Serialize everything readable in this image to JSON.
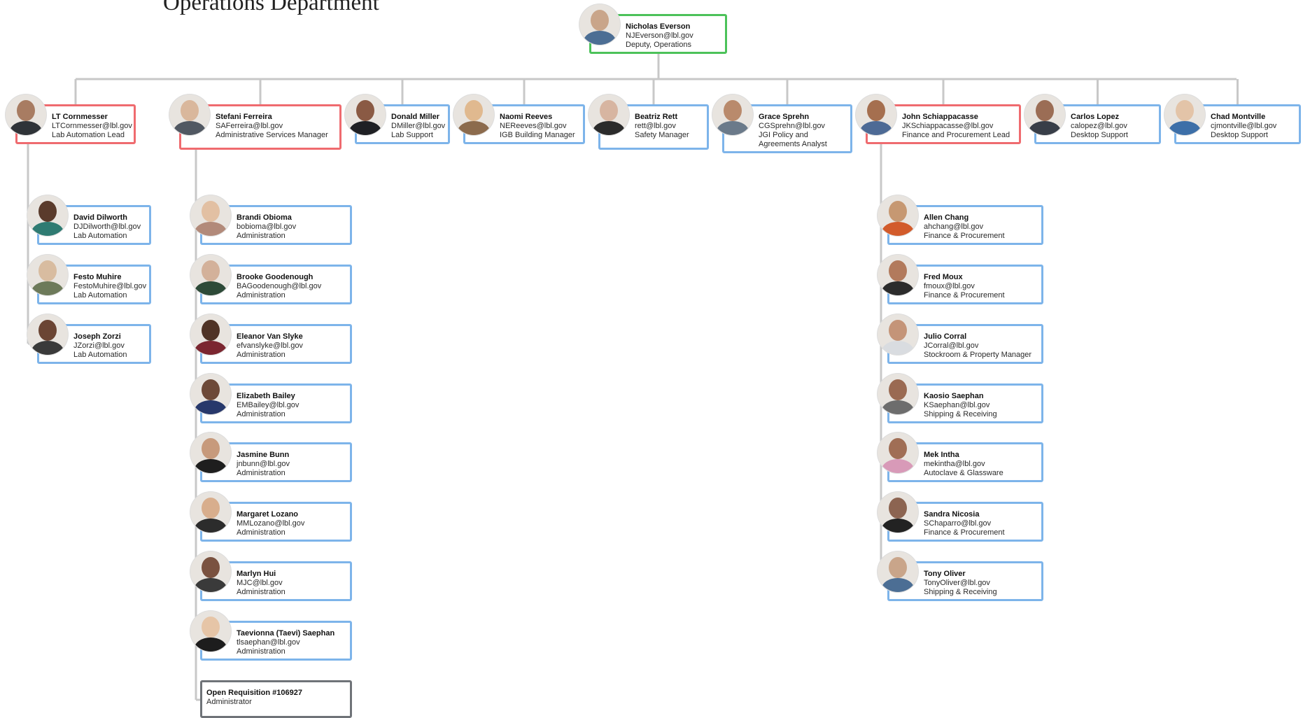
{
  "title": "Operations Department",
  "colors": {
    "line": "#c8c8c8",
    "manager_border": "#ef6b6f",
    "head_border": "#4cc25a",
    "staff_border": "#7db4ea",
    "open_border": "#6f7378"
  },
  "head": {
    "name": "Nicholas Everson",
    "email": "NJEverson@lbl.gov",
    "role": "Deputy, Operations"
  },
  "direct_reports": [
    {
      "name": "LT Cornmesser",
      "email": "LTCornmesser@lbl.gov",
      "role": "Lab Automation Lead"
    },
    {
      "name": "Stefani Ferreira",
      "email": "SAFerreira@lbl.gov",
      "role": "Administrative Services Manager"
    },
    {
      "name": "Donald Miller",
      "email": "DMiller@lbl.gov",
      "role": "Lab Support"
    },
    {
      "name": "Naomi Reeves",
      "email": "NEReeves@lbl.gov",
      "role": "IGB Building Manager"
    },
    {
      "name": "Beatriz Rett",
      "email": "rett@lbl.gov",
      "role": "Safety Manager"
    },
    {
      "name": "Grace Sprehn",
      "email": "CGSprehn@lbl.gov",
      "role": "JGI Policy and",
      "role2": "Agreements Analyst"
    },
    {
      "name": "John Schiappacasse",
      "email": "JKSchiappacasse@lbl.gov",
      "role": "Finance and Procurement Lead"
    },
    {
      "name": "Carlos Lopez",
      "email": "calopez@lbl.gov",
      "role": "Desktop Support"
    },
    {
      "name": "Chad Montville",
      "email": "cjmontville@lbl.gov",
      "role": "Desktop Support"
    }
  ],
  "lab_automation_team": [
    {
      "name": "David Dilworth",
      "email": "DJDilworth@lbl.gov",
      "role": "Lab Automation"
    },
    {
      "name": "Festo Muhire",
      "email": "FestoMuhire@lbl.gov",
      "role": "Lab Automation"
    },
    {
      "name": "Joseph Zorzi",
      "email": "JZorzi@lbl.gov",
      "role": "Lab Automation"
    }
  ],
  "administration_team": [
    {
      "name": "Brandi Obioma",
      "email": "bobioma@lbl.gov",
      "role": "Administration"
    },
    {
      "name": "Brooke Goodenough",
      "email": "BAGoodenough@lbl.gov",
      "role": "Administration"
    },
    {
      "name": "Eleanor Van Slyke",
      "email": "efvanslyke@lbl.gov",
      "role": "Administration"
    },
    {
      "name": "Elizabeth Bailey",
      "email": "EMBailey@lbl.gov",
      "role": "Administration"
    },
    {
      "name": "Jasmine Bunn",
      "email": "jnbunn@lbl.gov",
      "role": "Administration"
    },
    {
      "name": "Margaret Lozano",
      "email": "MMLozano@lbl.gov",
      "role": "Administration"
    },
    {
      "name": "Marlyn Hui",
      "email": "MJC@lbl.gov",
      "role": "Administration"
    },
    {
      "name": "Taevionna (Taevi) Saephan",
      "email": "tlsaephan@lbl.gov",
      "role": "Administration"
    }
  ],
  "open_requisition": {
    "name": "Open Requisition #106927",
    "role": "Administrator"
  },
  "finance_team": [
    {
      "name": "Allen Chang",
      "email": "ahchang@lbl.gov",
      "role": "Finance & Procurement"
    },
    {
      "name": "Fred Moux",
      "email": "fmoux@lbl.gov",
      "role": "Finance & Procurement"
    },
    {
      "name": "Julio Corral",
      "email": "JCorral@lbl.gov",
      "role": "Stockroom & Property Manager"
    },
    {
      "name": "Kaosio Saephan",
      "email": "KSaephan@lbl.gov",
      "role": "Shipping & Receiving"
    },
    {
      "name": "Mek Intha",
      "email": "mekintha@lbl.gov",
      "role": "Autoclave & Glassware"
    },
    {
      "name": "Sandra Nicosia",
      "email": "SChaparro@lbl.gov",
      "role": "Finance & Procurement"
    },
    {
      "name": "Tony Oliver",
      "email": "TonyOliver@lbl.gov",
      "role": "Shipping & Receiving"
    }
  ]
}
